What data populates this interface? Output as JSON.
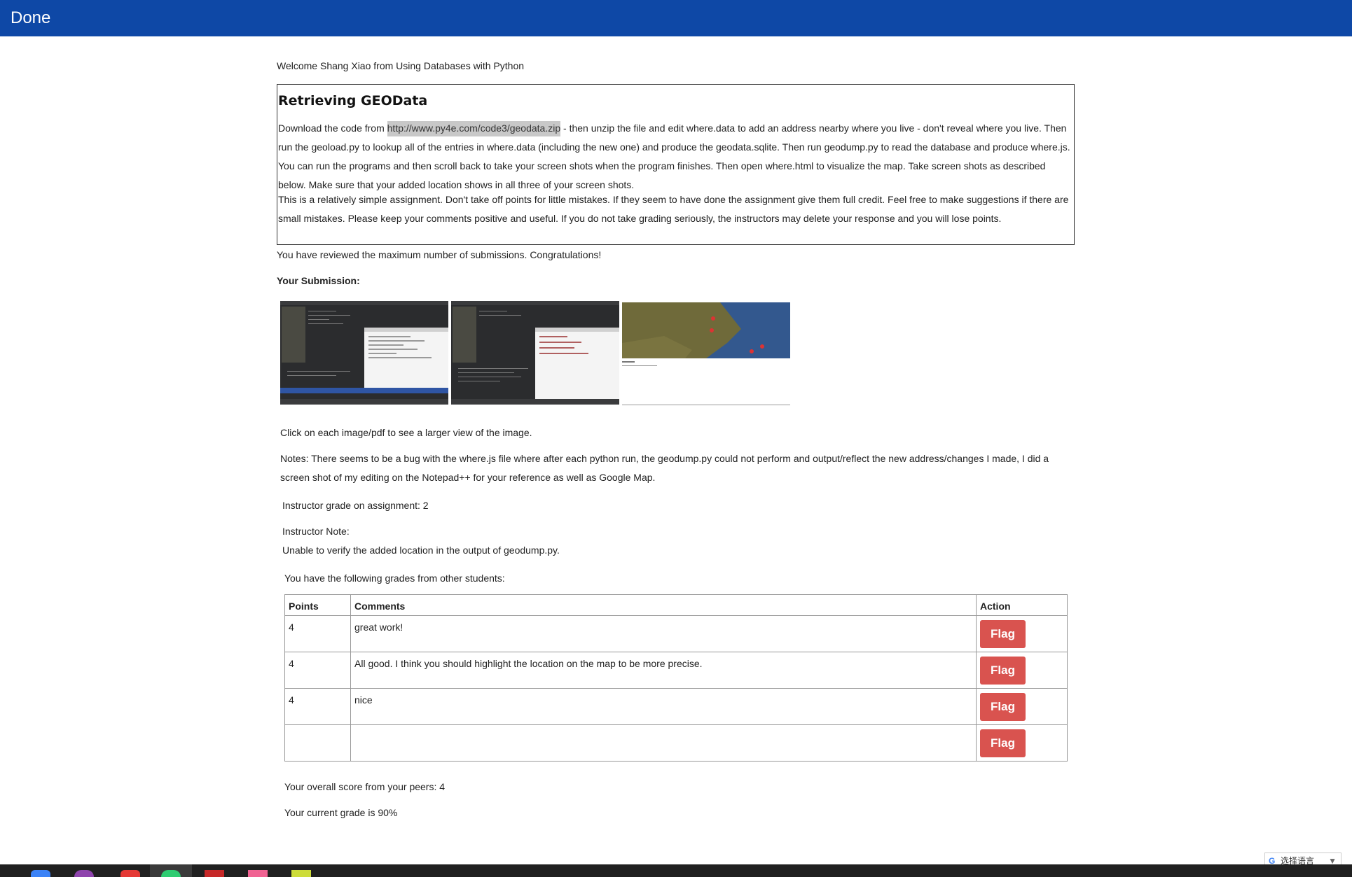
{
  "header": {
    "title": "Done"
  },
  "welcome": "Welcome Shang Xiao from Using Databases with Python",
  "assignment": {
    "title": "Retrieving GEOData",
    "p1_before": "Download the code from ",
    "p1_link": "http://www.py4e.com/code3/geodata.zip",
    "p1_after": " - then unzip the file and edit where.data to add an address nearby where you live - don't reveal where you live. Then run the geoload.py to lookup all of the entries in where.data (including the new one) and produce the geodata.sqlite. Then run geodump.py to read the database and produce where.js. You can run the programs and then scroll back to take your screen shots when the program finishes. Then open where.html to visualize the map. Take screen shots as described below. Make sure that your added location shows in all three of your screen shots.",
    "p2": "This is a relatively simple assignment. Don't take off points for little mistakes. If they seem to have done the assignment give them full credit. Feel free to make suggestions if there are small mistakes. Please keep your comments positive and useful. If you do not take grading seriously, the instructors may delete your response and you will lose points."
  },
  "reviewed_msg": "You have reviewed the maximum number of submissions. Congratulations!",
  "submission_label": "Your Submission:",
  "click_hint": "Click on each image/pdf to see a larger view of the image.",
  "notes": "Notes: There seems to be a bug with the where.js file where after each python run, the geodump.py could not perform and output/reflect the new address/changes I made, I did a screen shot of my editing on the Notepad++ for your reference as well as Google Map.",
  "instructor_grade": "Instructor grade on assignment: 2",
  "instructor_note_label": "Instructor Note:",
  "instructor_note": "Unable to verify the added location in the output of geodump.py.",
  "grades_intro": "You have the following grades from other students:",
  "table": {
    "headers": [
      "Points",
      "Comments",
      "Action"
    ],
    "rows": [
      {
        "points": "4",
        "comment": "great work!",
        "action": "Flag"
      },
      {
        "points": "4",
        "comment": "All good. I think you should highlight the location on the map to be more precise.",
        "action": "Flag"
      },
      {
        "points": "4",
        "comment": "nice",
        "action": "Flag"
      },
      {
        "points": "",
        "comment": "",
        "action": "Flag"
      }
    ]
  },
  "overall_score": "Your overall score from your peers: 4",
  "current_grade": "Your current grade is 90%",
  "translate_widget": "选择语言",
  "colors": {
    "header_bg": "#0e48a6",
    "flag_bg": "#d9534f"
  }
}
